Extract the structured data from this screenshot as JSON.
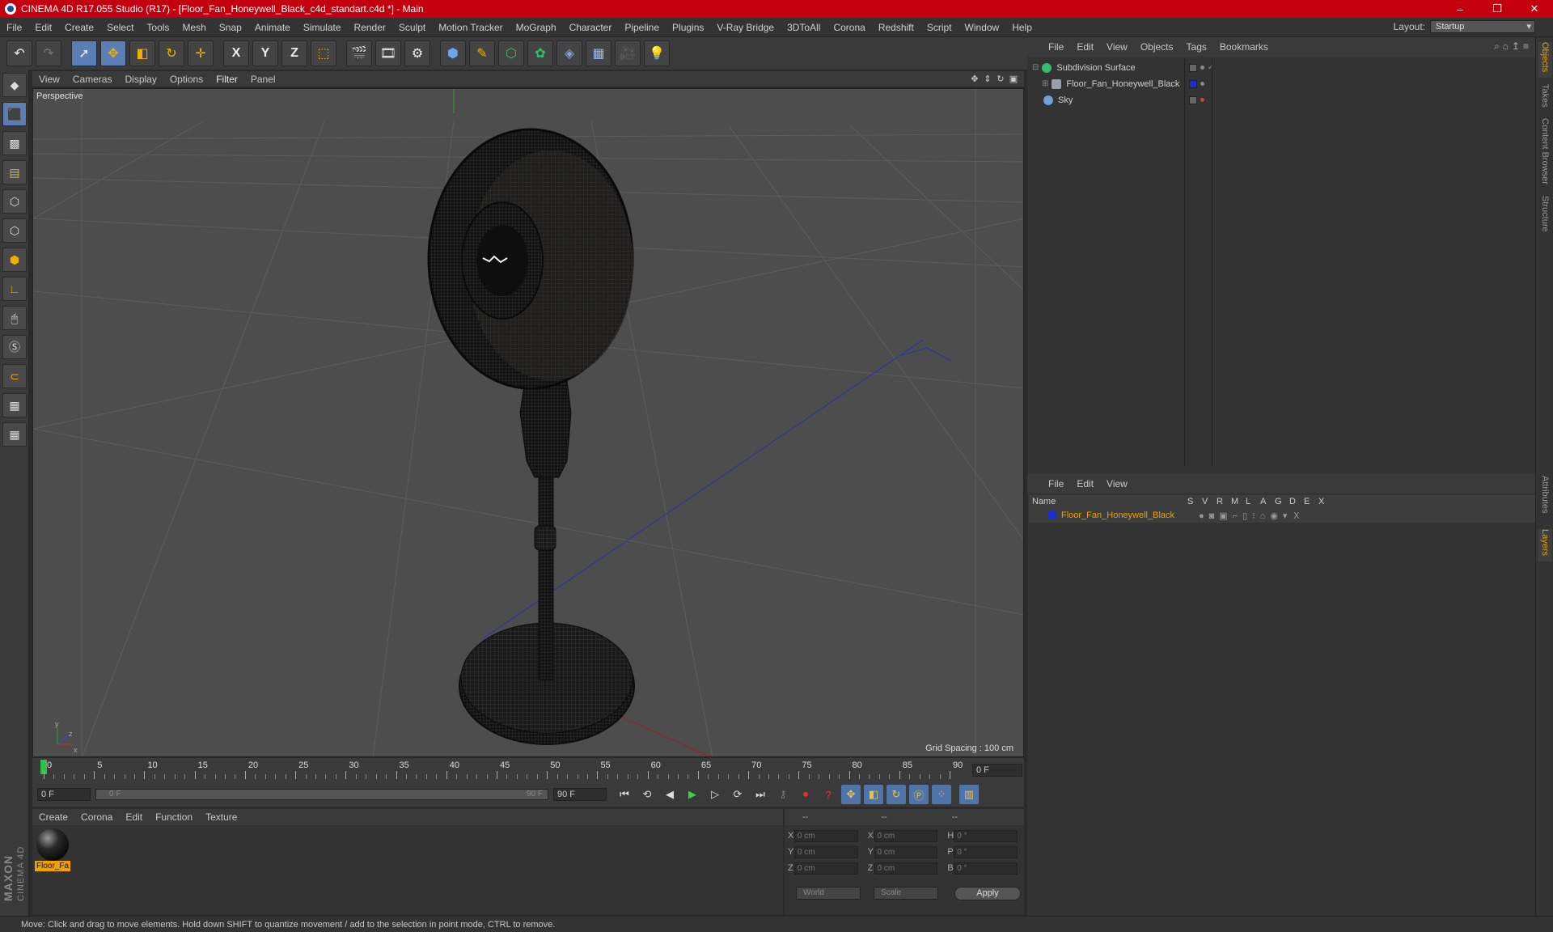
{
  "window": {
    "title": "CINEMA 4D R17.055 Studio (R17) - [Floor_Fan_Honeywell_Black_c4d_standart.c4d *] - Main",
    "controls": [
      "–",
      "❐",
      "✕"
    ]
  },
  "menu": [
    "File",
    "Edit",
    "Create",
    "Select",
    "Tools",
    "Mesh",
    "Snap",
    "Animate",
    "Simulate",
    "Render",
    "Sculpt",
    "Motion Tracker",
    "MoGraph",
    "Character",
    "Pipeline",
    "Plugins",
    "V-Ray Bridge",
    "3DToAll",
    "Corona",
    "Redshift",
    "Script",
    "Window",
    "Help"
  ],
  "layout": {
    "label": "Layout:",
    "value": "Startup"
  },
  "toolbar": {
    "undo_icon": "undo-icon",
    "redo_icon": "redo-icon",
    "axis_x": "X",
    "axis_y": "Y",
    "axis_z": "Z"
  },
  "viewport": {
    "menu": [
      "View",
      "Cameras",
      "Display",
      "Options",
      "Filter",
      "Panel"
    ],
    "camera_label": "Perspective",
    "grid_spacing": "Grid Spacing : 100 cm"
  },
  "timeline": {
    "ticks": [
      "0",
      "5",
      "10",
      "15",
      "20",
      "25",
      "30",
      "35",
      "40",
      "45",
      "50",
      "55",
      "60",
      "65",
      "70",
      "75",
      "80",
      "85",
      "90"
    ],
    "current_frame": "0 F",
    "start_frame": "0 F",
    "slider_start": "0 F",
    "slider_end": "90 F",
    "end_frame": "90 F"
  },
  "materials": {
    "menu": [
      "Create",
      "Corona",
      "Edit",
      "Function",
      "Texture"
    ],
    "items": [
      {
        "name": "Floor_Fa"
      }
    ]
  },
  "coordinates": {
    "header": [
      "--",
      "--",
      "--"
    ],
    "rows": [
      {
        "a1": "X",
        "v1": "0 cm",
        "a2": "X",
        "v2": "0 cm",
        "a3": "H",
        "v3": "0 °"
      },
      {
        "a1": "Y",
        "v1": "0 cm",
        "a2": "Y",
        "v2": "0 cm",
        "a3": "P",
        "v3": "0 °"
      },
      {
        "a1": "Z",
        "v1": "0 cm",
        "a2": "Z",
        "v2": "0 cm",
        "a3": "B",
        "v3": "0 °"
      }
    ],
    "space": "World",
    "mode": "Scale",
    "apply": "Apply"
  },
  "object_manager": {
    "menu": [
      "File",
      "Edit",
      "View",
      "Objects",
      "Tags",
      "Bookmarks"
    ],
    "objects": [
      {
        "name": "Subdivision Surface",
        "icon_color": "#34c06a"
      },
      {
        "name": "Floor_Fan_Honeywell_Black",
        "icon_color": "#9aa0a8"
      },
      {
        "name": "Sky",
        "icon_color": "#6fa0d8"
      }
    ]
  },
  "layer_manager": {
    "menu": [
      "File",
      "Edit",
      "View"
    ],
    "columns": [
      "Name",
      "S",
      "V",
      "R",
      "M",
      "L",
      "A",
      "G",
      "D",
      "E",
      "X"
    ],
    "layers": [
      {
        "name": "Floor_Fan_Honeywell_Black",
        "color": "#1a2fd0"
      }
    ]
  },
  "side_tabs": [
    "Objects",
    "Takes",
    "Content Browser",
    "Structure",
    "Attributes",
    "Layers"
  ],
  "status": "Move: Click and drag to move elements. Hold down SHIFT to quantize movement / add to the selection in point mode, CTRL to remove.",
  "logo": {
    "brand": "MAXON",
    "product": "CINEMA 4D"
  },
  "colors": {
    "titlebar": "#c4000e",
    "accent": "#f0a000",
    "playhead": "#2fc24a"
  }
}
